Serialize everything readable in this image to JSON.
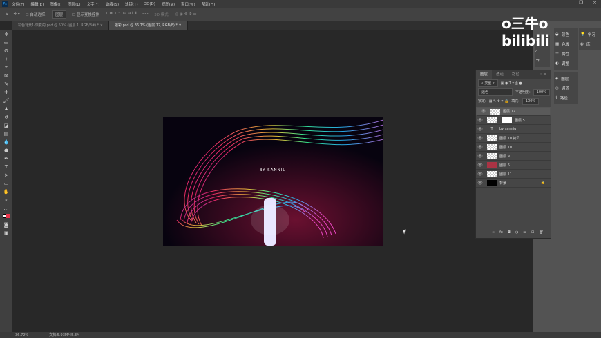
{
  "app": {
    "logo": "Ps"
  },
  "menu": [
    "文件(F)",
    "编辑(E)",
    "图像(I)",
    "图层(L)",
    "文字(Y)",
    "选择(S)",
    "滤镜(T)",
    "3D(D)",
    "视图(V)",
    "窗口(W)",
    "帮助(H)"
  ],
  "window_controls": [
    "–",
    "❐",
    "×"
  ],
  "options": {
    "auto_select": "自动选择:",
    "auto_select_value": "图层",
    "show_transform": "显示变换控件",
    "mode_3d": "3D 模式:"
  },
  "tabs": [
    {
      "label": "彩色背景1-恢复的.psd @ 50% (图层 1, RGB/8#) *",
      "close": "×"
    },
    {
      "label": "摇彩.psd @ 36.7% (图层 12, RGB/8) *",
      "close": "×"
    }
  ],
  "artwork": {
    "text": "BY SANNIU"
  },
  "status": {
    "zoom": "36.72%",
    "doc": "文档:5.93M/45.3M"
  },
  "watermark": "o三牛o bilibili",
  "dock": {
    "col1": [
      "颜色",
      "色板",
      "属性",
      "调整"
    ],
    "col2": [
      "学习",
      "库"
    ],
    "col3": [
      "图层",
      "通道",
      "路径"
    ]
  },
  "layers_panel": {
    "tabs": [
      "图层",
      "通道",
      "路径"
    ],
    "filter": "类型",
    "blend": "透色",
    "opacity_label": "不透明度:",
    "opacity": "100%",
    "lock_label": "锁定:",
    "fill_label": "填充:",
    "fill": "100%",
    "layers": [
      {
        "name": "图层 12",
        "selected": true
      },
      {
        "name": "图层 5",
        "mask": true
      },
      {
        "name": "by sanniu",
        "type": "text"
      },
      {
        "name": "图层 10 拷贝"
      },
      {
        "name": "图层 10"
      },
      {
        "name": "图层 9"
      },
      {
        "name": "图层 6"
      },
      {
        "name": "图层 11"
      },
      {
        "name": "背景",
        "locked": true
      }
    ]
  }
}
